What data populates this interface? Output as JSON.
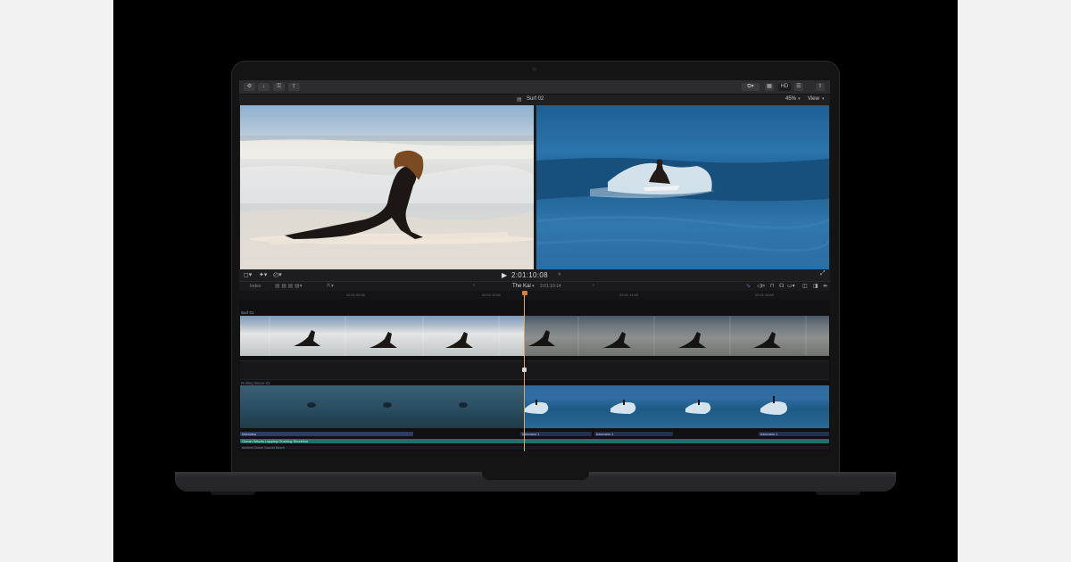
{
  "app": {
    "viewer_title": "Surf 02",
    "zoom_label": "45%",
    "view_label": "View",
    "timecode": "2:01:10:08",
    "toolbar_badge": "HD"
  },
  "timeline": {
    "index_label": "Index",
    "project_name": "The Kai",
    "duration": "2:01:10:14",
    "ruler_ticks": [
      "02:01:06:00",
      "02:01:10:00",
      "02:01:14:00",
      "02:01:18:00"
    ],
    "track_labels": {
      "primary_clip": "Surf 01",
      "secondary_clip": "Rolling Wave 01"
    },
    "bars": {
      "row1_left": "Interview",
      "row1_mid": "Interview 1",
      "row1_mid2": "Interview 1",
      "row1_right": "Interview 1",
      "row2": "Ocean Waves Lapping Gushing Shoreline",
      "row3": "Ambient Ocean Sounds Beach"
    }
  },
  "colors": {
    "playhead": "#e07b39",
    "audio_bar": "#2a3b66",
    "music_bar": "#1f6f6a"
  }
}
